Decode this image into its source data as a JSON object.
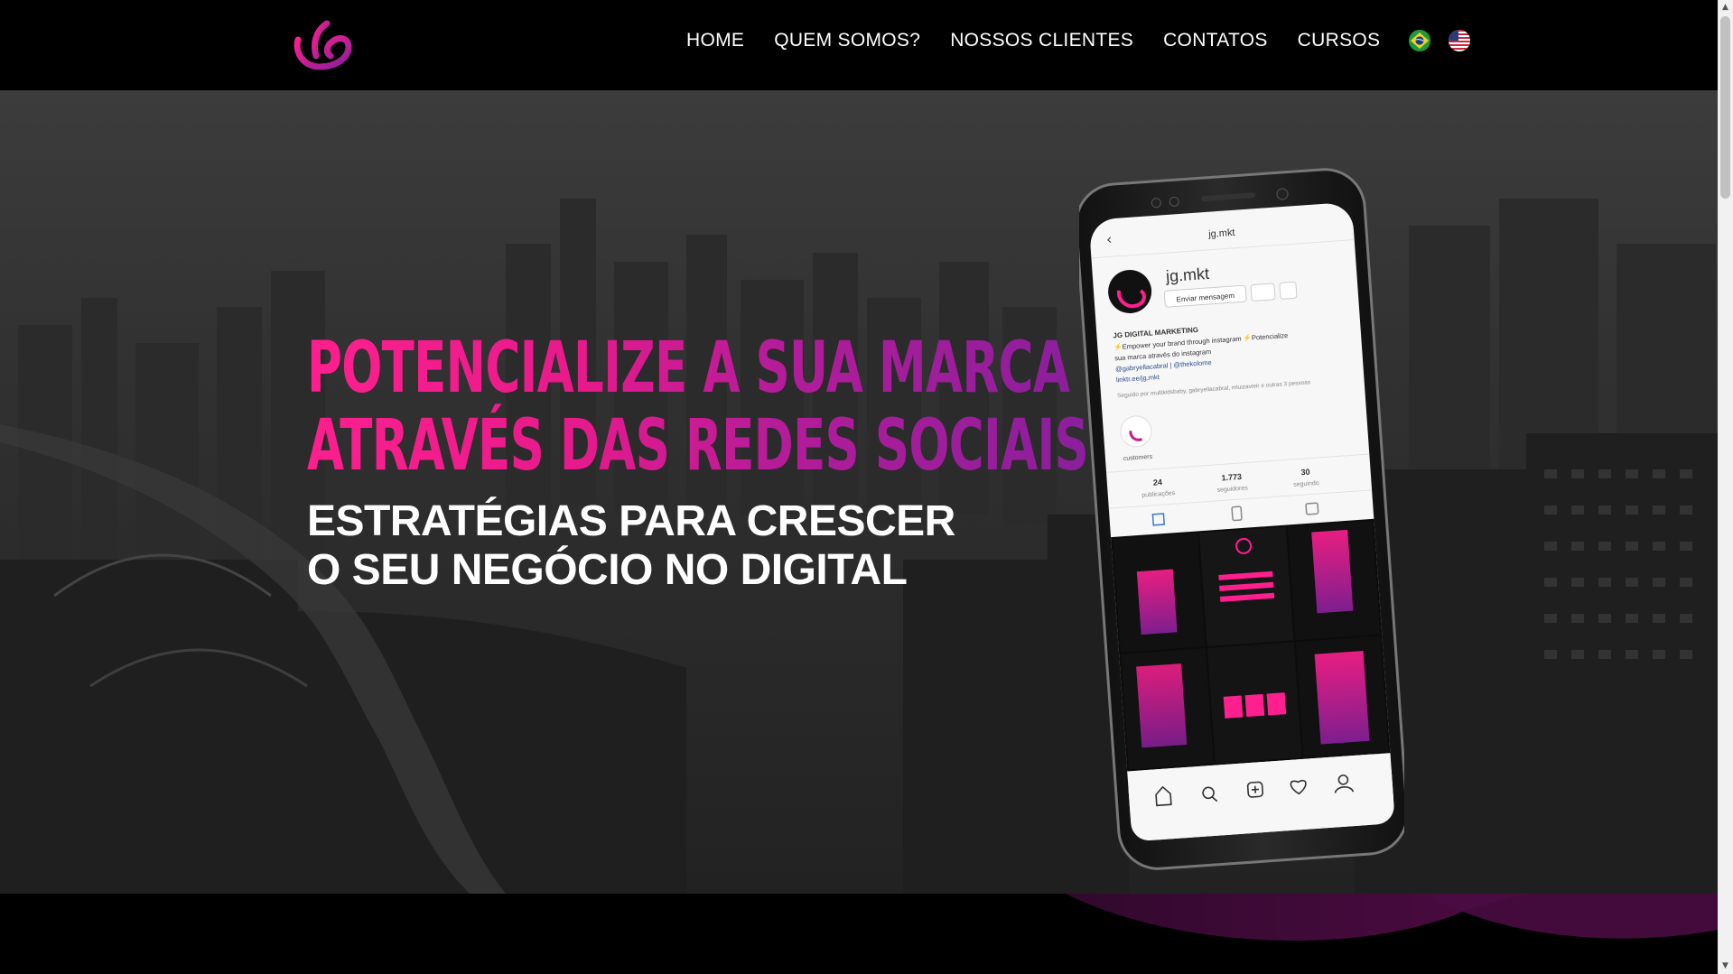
{
  "nav": {
    "items": [
      {
        "label": "HOME"
      },
      {
        "label": "QUEM SOMOS?"
      },
      {
        "label": "NOSSOS CLIENTES"
      },
      {
        "label": "CONTATOS"
      },
      {
        "label": "CURSOS"
      }
    ],
    "languages": [
      {
        "icon": "brazil-flag-icon"
      },
      {
        "icon": "usa-flag-icon"
      }
    ]
  },
  "logo": {
    "icon": "jg-logo-icon"
  },
  "hero": {
    "headline_line1": "POTENCIALIZE A SUA MARCA",
    "headline_line2": "ATRAVÉS DAS REDES SOCIAIS",
    "sub_line1": "ESTRATÉGIAS PARA CRESCER",
    "sub_line2": "O SEU NEGÓCIO NO DIGITAL"
  },
  "phone": {
    "header_title": "jg.mkt",
    "username": "jg.mkt",
    "message_button": "Enviar mensagem",
    "bio_name": "JG DIGITAL MARKETING",
    "bio_line1": "⚡Empower your brand through instagram ⚡Potencialize",
    "bio_line2": "sua marca através do instagram",
    "bio_line3": "@gabryellacabral | @thekolome",
    "bio_link": "linktr.ee/jg.mkt",
    "followed_by": "Seguido por multikidsbaby, gabryellacabral, mluizavieir e outras 3 pessoas",
    "highlight_label": "customers",
    "stats": [
      {
        "value": "24",
        "label": "publicações"
      },
      {
        "value": "1.773",
        "label": "seguidores"
      },
      {
        "value": "30",
        "label": "seguindo"
      }
    ]
  },
  "colors": {
    "accent_pink": "#ff1f8e",
    "accent_purple": "#8a1f9c",
    "nav_bg": "#000000"
  }
}
